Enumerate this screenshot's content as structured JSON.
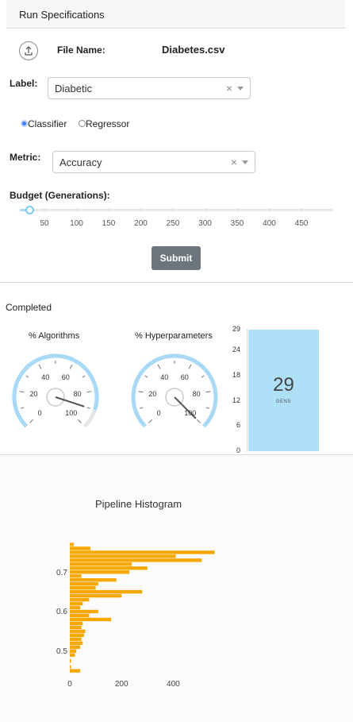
{
  "card": {
    "title": "Run Specifications"
  },
  "file": {
    "label": "File Name:",
    "value": "Diabetes.csv",
    "upload_icon": "upload-icon"
  },
  "label_select": {
    "label": "Label:",
    "value": "Diabetic",
    "clear": "×"
  },
  "mode": {
    "options": [
      {
        "label": "Classifier",
        "selected": true
      },
      {
        "label": "Regressor",
        "selected": false
      }
    ]
  },
  "metric_select": {
    "label": "Metric:",
    "value": "Accuracy",
    "clear": "×"
  },
  "budget": {
    "label": "Budget (Generations):",
    "ticks": [
      "50",
      "100",
      "150",
      "200",
      "250",
      "300",
      "350",
      "400",
      "450"
    ],
    "value": 0
  },
  "submit": {
    "label": "Submit"
  },
  "status": {
    "text": "Completed"
  },
  "gauges": [
    {
      "title": "% Algorithms",
      "value": 90,
      "ticks": [
        "0",
        "20",
        "40",
        "60",
        "80",
        "100"
      ]
    },
    {
      "title": "% Hyperparameters",
      "value": 100,
      "ticks": [
        "0",
        "20",
        "40",
        "60",
        "80",
        "100"
      ]
    }
  ],
  "gens": {
    "value": "29",
    "unit": "GENS",
    "ticks": [
      "0",
      "6",
      "12",
      "18",
      "24",
      "29"
    ],
    "max": 29,
    "fill": 29,
    "color": "#aee0f8"
  },
  "chart_data": {
    "type": "bar",
    "title": "Pipeline Histogram",
    "orientation": "horizontal",
    "xlim": [
      0,
      560
    ],
    "ylim": [
      0.44,
      0.79
    ],
    "x_ticks": [
      "0",
      "200",
      "400"
    ],
    "y_ticks": [
      "0.5",
      "0.6",
      "0.7"
    ],
    "color": "#f6a800",
    "bins": [
      0.455,
      0.465,
      0.48,
      0.495,
      0.505,
      0.515,
      0.525,
      0.535,
      0.545,
      0.555,
      0.565,
      0.575,
      0.585,
      0.595,
      0.605,
      0.615,
      0.625,
      0.635,
      0.645,
      0.655,
      0.665,
      0.675,
      0.685,
      0.695,
      0.705,
      0.715,
      0.725,
      0.735,
      0.745,
      0.755,
      0.765,
      0.775
    ],
    "values": [
      40,
      5,
      5,
      20,
      25,
      40,
      50,
      45,
      55,
      60,
      45,
      50,
      160,
      75,
      110,
      40,
      50,
      75,
      200,
      280,
      100,
      110,
      180,
      45,
      230,
      300,
      240,
      510,
      410,
      560,
      80,
      15
    ]
  }
}
